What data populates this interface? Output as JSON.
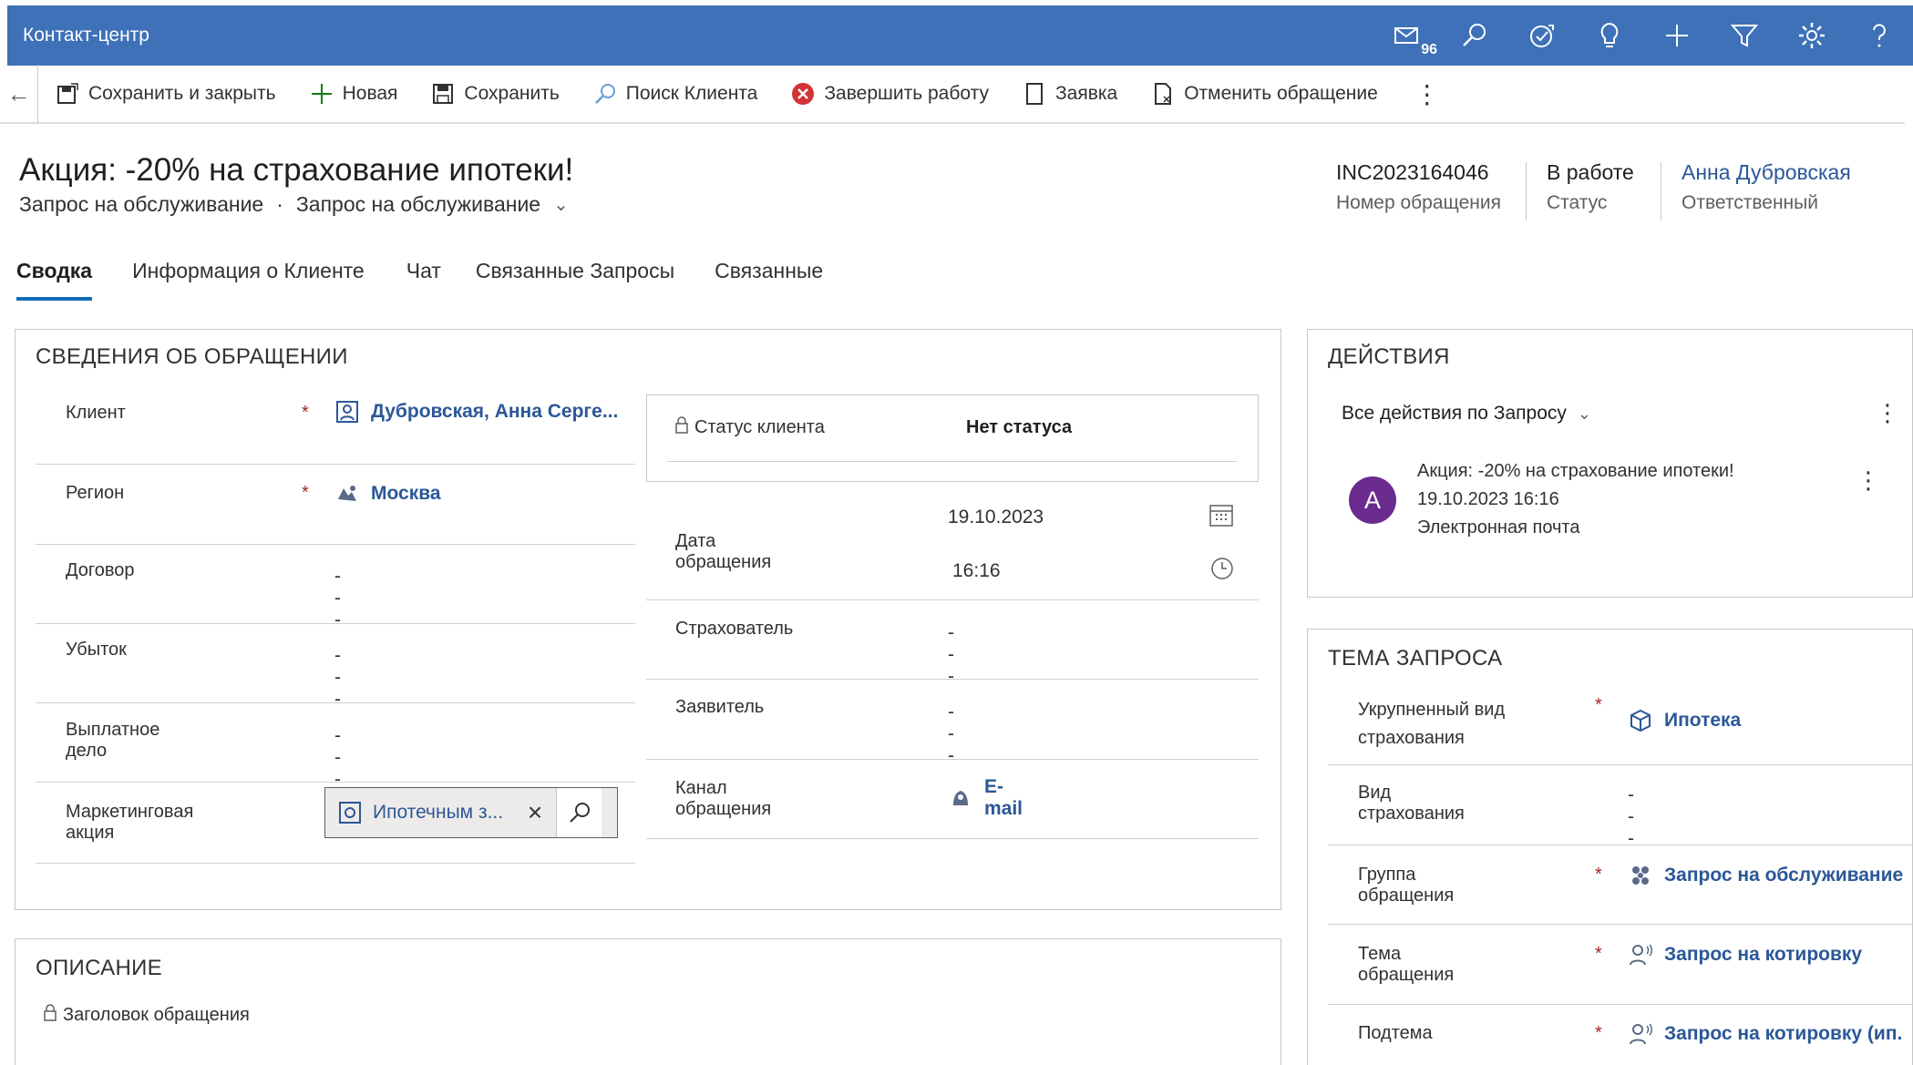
{
  "app": {
    "title": "Контакт-центр",
    "notification_count": "96"
  },
  "topbar_icons": [
    "envelope-icon",
    "search-icon",
    "task-icon",
    "lightbulb-icon",
    "plus-icon",
    "filter-icon",
    "gear-icon",
    "help-icon"
  ],
  "commands": {
    "save_close": "Сохранить и закрыть",
    "new": "Новая",
    "save": "Сохранить",
    "search_client": "Поиск Клиента",
    "finish": "Завершить работу",
    "request": "Заявка",
    "cancel": "Отменить обращение",
    "more": "⋮"
  },
  "record": {
    "title": "Акция: -20% на страхование ипотеки!",
    "entity": "Запрос на обслуживание",
    "form": "Запрос на обслуживание",
    "separator": "·",
    "number_value": "INC2023164046",
    "number_label": "Номер обращения",
    "status_value": "В работе",
    "status_label": "Статус",
    "owner_value": "Анна Дубровская",
    "owner_label": "Ответственный"
  },
  "tabs": [
    "Сводка",
    "Информация о Клиенте",
    "Чат",
    "Связанные Запросы",
    "Связанные"
  ],
  "details": {
    "title": "СВЕДЕНИЯ ОБ ОБРАЩЕНИИ",
    "client_label": "Клиент",
    "client_value": "Дубровская, Анна Серге...",
    "region_label": "Регион",
    "region_value": "Москва",
    "contract_label": "Договор",
    "contract_value": "---",
    "loss_label": "Убыток",
    "loss_value": "---",
    "payout_label": "Выплатное дело",
    "payout_value": "---",
    "marketing_label": "Маркетинговая акция",
    "marketing_value": "Ипотечным з...",
    "client_status_label": "Статус клиента",
    "client_status_value": "Нет статуса",
    "date_label": "Дата обращения",
    "date_value": "19.10.2023",
    "time_value": "16:16",
    "insurer_label": "Страхователь",
    "insurer_value": "---",
    "applicant_label": "Заявитель",
    "applicant_value": "---",
    "channel_label": "Канал обращения",
    "channel_value": "E-mail",
    "required_mark": "*"
  },
  "description": {
    "title": "ОПИСАНИЕ",
    "subject_label": "Заголовок обращения"
  },
  "actions": {
    "title": "ДЕЙСТВИЯ",
    "filter": "Все действия по Запросу",
    "item_avatar": "A",
    "item_title": "Акция: -20% на страхование ипотеки!",
    "item_date": "19.10.2023 16:16",
    "item_type": "Электронная почта"
  },
  "topic": {
    "title": "ТЕМА ЗАПРОСА",
    "kind_label_1": "Укрупненный вид",
    "kind_label_2": "страхования",
    "kind_value": "Ипотека",
    "type_label": "Вид страхования",
    "type_value": "---",
    "group_label": "Группа обращения",
    "group_value": "Запрос на обслуживание",
    "subject_label": "Тема обращения",
    "subject_value": "Запрос на котировку",
    "subtopic_label": "Подтема",
    "subtopic_value": "Запрос на котировку (ип."
  },
  "colors": {
    "topbar": "#3e71b8",
    "link": "#2b5797",
    "required": "#a4262c",
    "avatar": "#6b2b8e",
    "tab_underline": "#0f6cbd"
  }
}
